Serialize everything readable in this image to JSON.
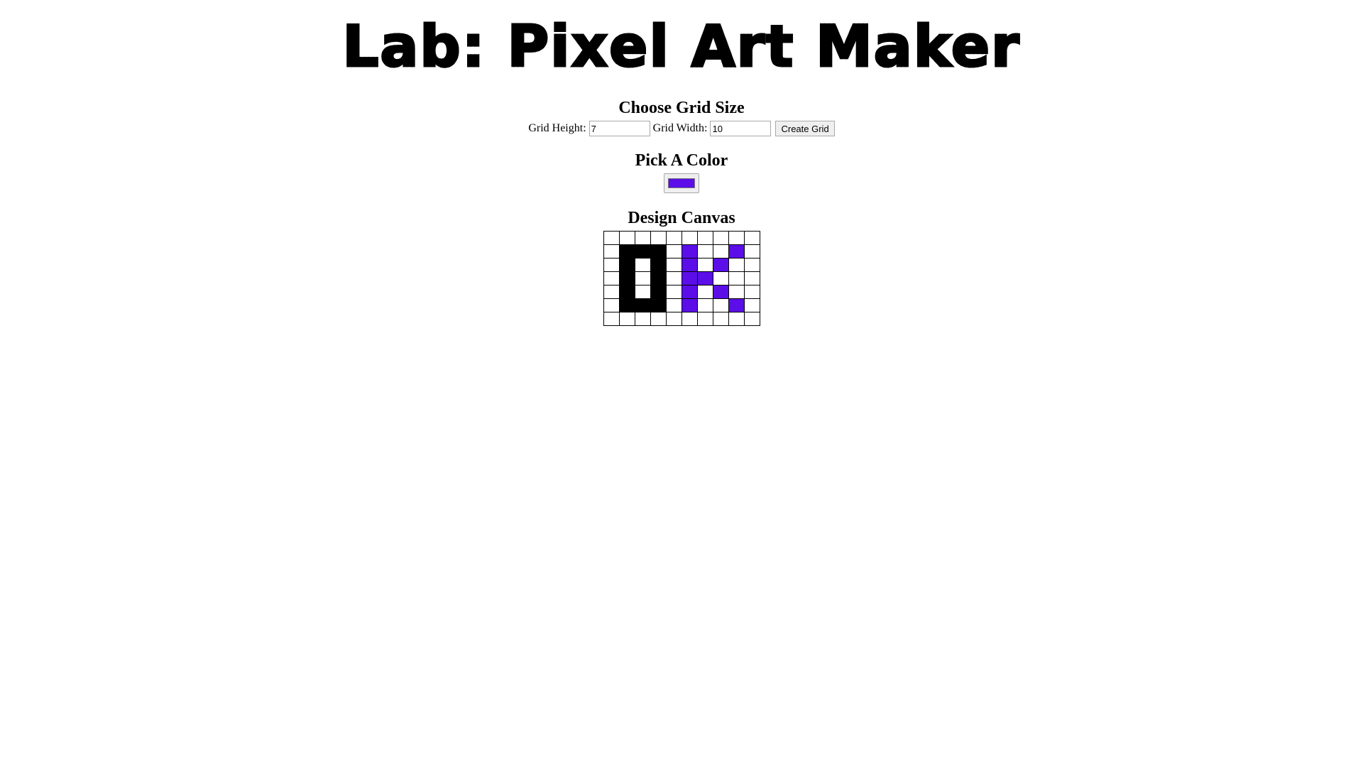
{
  "header": {
    "title": "Lab: Pixel Art Maker"
  },
  "grid_size": {
    "heading": "Choose Grid Size",
    "height_label": "Grid Height:",
    "height_value": "7",
    "width_label": "Grid Width:",
    "width_value": "10",
    "submit_label": "Create Grid"
  },
  "color": {
    "heading": "Pick A Color",
    "value": "#5b0ee8"
  },
  "canvas": {
    "heading": "Design Canvas",
    "rows": 7,
    "cols": 10,
    "cells": [
      [
        "",
        "",
        "",
        "",
        "",
        "",
        "",
        "",
        "",
        ""
      ],
      [
        "",
        "#000000",
        "#000000",
        "#000000",
        "",
        "#5b0ee8",
        "",
        "",
        "#5b0ee8",
        ""
      ],
      [
        "",
        "#000000",
        "",
        "#000000",
        "",
        "#5b0ee8",
        "",
        "#5b0ee8",
        "",
        ""
      ],
      [
        "",
        "#000000",
        "",
        "#000000",
        "",
        "#5b0ee8",
        "#5b0ee8",
        "",
        "",
        ""
      ],
      [
        "",
        "#000000",
        "",
        "#000000",
        "",
        "#5b0ee8",
        "",
        "#5b0ee8",
        "",
        ""
      ],
      [
        "",
        "#000000",
        "#000000",
        "#000000",
        "",
        "#5b0ee8",
        "",
        "",
        "#5b0ee8",
        ""
      ],
      [
        "",
        "",
        "",
        "",
        "",
        "",
        "",
        "",
        "",
        ""
      ]
    ]
  }
}
